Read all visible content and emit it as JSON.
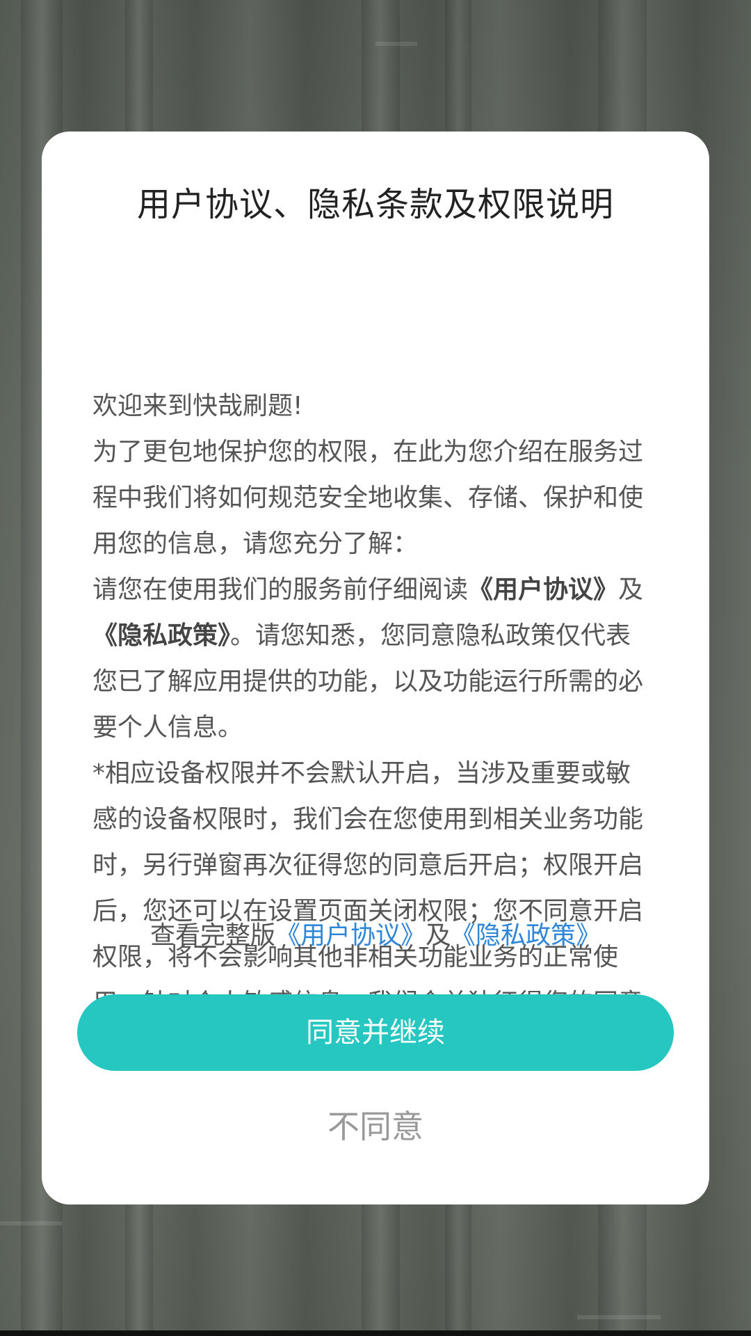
{
  "dialog": {
    "title": "用户协议、隐私条款及权限说明",
    "intro_greeting": "欢迎来到快哉刷题!",
    "paragraph_1": "为了更包地保护您的权限，在此为您介绍在服务过程中我们将如何规范安全地收集、存储、保护和使用您的信息，请您充分了解：",
    "paragraph_2_pre": "请您在使用我们的服务前仔细阅读",
    "agreement_name": "《用户协议》",
    "and_text": "及",
    "privacy_name": "《隐私政策》",
    "paragraph_2_post": "。请您知悉，您同意隐私政策仅代表您已了解应用提供的功能，以及功能运行所需的必要个人信息。",
    "paragraph_3": "*相应设备权限并不会默认开启，当涉及重要或敏感的设备权限时，我们会在您使用到相关业务功能时，另行弹窗再次征得您的同意后开启；权限开启后，您还可以在设置页面关闭权限；您不同意开启权限，将不会影响其他非相关功能业务的正常使用。针对个人敏感信息，我们会单独征得您的同意",
    "view_full_prefix": "查看完整版",
    "view_full_agreement_link": "《用户协议》",
    "view_full_and": "及",
    "view_full_privacy_link": "《隐私政策》",
    "agree_button_label": "同意并继续",
    "disagree_button_label": "不同意"
  },
  "colors": {
    "accent": "#26c6c1",
    "link": "#2f86d6",
    "backdrop": "#5a6058"
  }
}
